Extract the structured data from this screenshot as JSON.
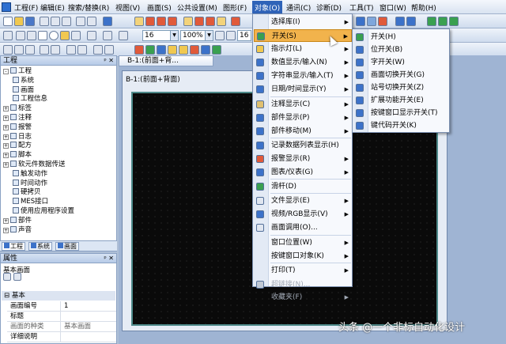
{
  "menubar": {
    "items": [
      "工程(F)",
      "编辑(E)",
      "搜索/替换(R)",
      "视图(V)",
      "画面(S)",
      "公共设置(M)",
      "图形(F)",
      "对象(O)",
      "通讯(C)",
      "诊断(D)",
      "工具(T)",
      "窗口(W)",
      "帮助(H)"
    ],
    "active_index": 7
  },
  "toolbar": {
    "font_size": "16",
    "zoom": "100%",
    "grid_size": "16"
  },
  "project_panel": {
    "title": "工程",
    "pin": "ᵖ ✕",
    "tree": [
      {
        "label": "工程",
        "level": 0,
        "exp": "-"
      },
      {
        "label": "系统",
        "level": 1
      },
      {
        "label": "画面",
        "level": 1
      },
      {
        "label": "工程信息",
        "level": 1
      },
      {
        "label": "标签",
        "level": 0,
        "exp": "+"
      },
      {
        "label": "注释",
        "level": 0,
        "exp": "+"
      },
      {
        "label": "报警",
        "level": 0,
        "exp": "+"
      },
      {
        "label": "日志",
        "level": 0,
        "exp": "+"
      },
      {
        "label": "配方",
        "level": 0,
        "exp": "+"
      },
      {
        "label": "脚本",
        "level": 0,
        "exp": "+"
      },
      {
        "label": "软元件数据传送",
        "level": 0,
        "exp": "+"
      },
      {
        "label": "触发动作",
        "level": 1
      },
      {
        "label": "时间动作",
        "level": 1
      },
      {
        "label": "硬拷贝",
        "level": 1
      },
      {
        "label": "MES接口",
        "level": 1
      },
      {
        "label": "使用应用程序设置",
        "level": 1
      },
      {
        "label": "部件",
        "level": 0,
        "exp": "+"
      },
      {
        "label": "声音",
        "level": 0,
        "exp": "+"
      }
    ],
    "tabs": [
      "工程",
      "系统",
      "画面"
    ]
  },
  "properties_panel": {
    "title": "属性",
    "pin": "ᵖ ✕",
    "object": "基本画面",
    "section": "基本",
    "rows": [
      {
        "key": "画面编号",
        "value": "1"
      },
      {
        "key": "标题",
        "value": ""
      },
      {
        "key": "画面的种类",
        "value": "基本画面"
      },
      {
        "key": "详细说明",
        "value": ""
      }
    ]
  },
  "document": {
    "tab_title": "B-1:(前面+背...",
    "window_title": "B-1:(前面+背面)"
  },
  "object_menu": {
    "items": [
      {
        "label": "选择库(I)",
        "arrow": true
      },
      {
        "label": "开关(S)",
        "arrow": true,
        "highlight": true
      },
      {
        "label": "指示灯(L)",
        "arrow": true
      },
      {
        "label": "数值显示/输入(N)",
        "arrow": true
      },
      {
        "label": "字符串显示/输入(T)",
        "arrow": true
      },
      {
        "label": "日期/时间显示(Y)",
        "arrow": true
      },
      {
        "label": "注释显示(C)",
        "arrow": true
      },
      {
        "label": "部件显示(P)",
        "arrow": true
      },
      {
        "label": "部件移动(M)",
        "arrow": true
      },
      {
        "label": "记录数据列表显示(H)",
        "arrow": false
      },
      {
        "label": "报警显示(R)",
        "arrow": true
      },
      {
        "label": "图表/仪表(G)",
        "arrow": true
      },
      {
        "label": "滑杆(D)",
        "arrow": false
      },
      {
        "label": "文件显示(E)",
        "arrow": true
      },
      {
        "label": "视频/RGB显示(V)",
        "arrow": true
      },
      {
        "label": "画面调用(O)...",
        "arrow": false
      },
      {
        "label": "窗口位置(W)",
        "arrow": true
      },
      {
        "label": "按键窗口对象(K)",
        "arrow": true
      },
      {
        "label": "打印(T)",
        "arrow": true
      },
      {
        "label": "超链接(N)...",
        "arrow": false,
        "disabled": true
      },
      {
        "label": "收藏夹(F)",
        "arrow": true,
        "disabled": true
      }
    ]
  },
  "switch_submenu": {
    "items": [
      "开关(H)",
      "位开关(B)",
      "字开关(W)",
      "画面切换开关(G)",
      "站号切换开关(Z)",
      "扩展功能开关(E)",
      "按键窗口显示开关(T)",
      "键代码开关(K)"
    ]
  },
  "watermark": "头条 @一个非标自动化设计",
  "colors": {
    "menu_highlight": "#f2b34c",
    "active_menu": "#2f63b8",
    "canvas": "#0a0a0a"
  }
}
